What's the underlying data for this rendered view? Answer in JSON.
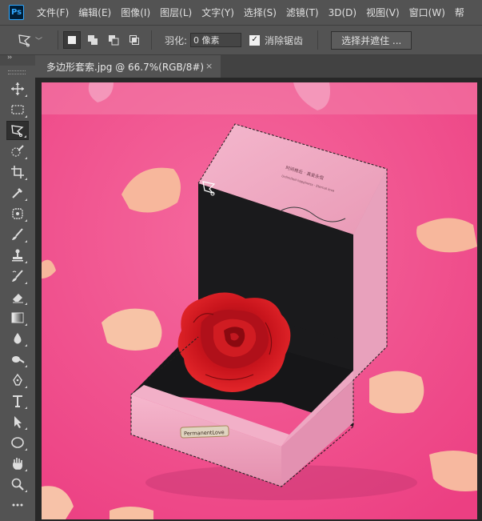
{
  "app": {
    "logo": "Ps"
  },
  "menu": [
    "文件(F)",
    "编辑(E)",
    "图像(I)",
    "图层(L)",
    "文字(Y)",
    "选择(S)",
    "滤镜(T)",
    "3D(D)",
    "视图(V)",
    "窗口(W)",
    "帮"
  ],
  "options": {
    "tool_icon": "polygonal-lasso-icon",
    "selection_modes": [
      "new-selection-icon",
      "add-selection-icon",
      "subtract-selection-icon",
      "intersect-selection-icon"
    ],
    "feather_label": "羽化:",
    "feather_value": "0 像素",
    "antialias_checked": true,
    "antialias_label": "消除锯齿",
    "select_mask_label": "选择并遮住 ..."
  },
  "document": {
    "tab_title": "多边形套索.jpg @ 66.7%(RGB/8#)",
    "close": "×"
  },
  "tools": [
    "move-icon",
    "marquee-icon",
    "polygonal-lasso-icon",
    "quick-select-icon",
    "crop-icon",
    "eyedropper-icon",
    "healing-brush-icon",
    "brush-icon",
    "clone-stamp-icon",
    "history-brush-icon",
    "eraser-icon",
    "gradient-icon",
    "blur-icon",
    "dodge-icon",
    "pen-icon",
    "type-icon",
    "path-select-icon",
    "ellipse-icon",
    "hand-icon",
    "zoom-icon"
  ],
  "image": {
    "background_color": "#f04f8c",
    "box_color": "#f2aac4",
    "rose_color": "#c8141c",
    "box_text_1": "时间格云 · 真爱永恒",
    "box_text_2": "Unlimited happiness · Eternal love",
    "plaque_text": "PermanentLove",
    "collapse": "››"
  }
}
